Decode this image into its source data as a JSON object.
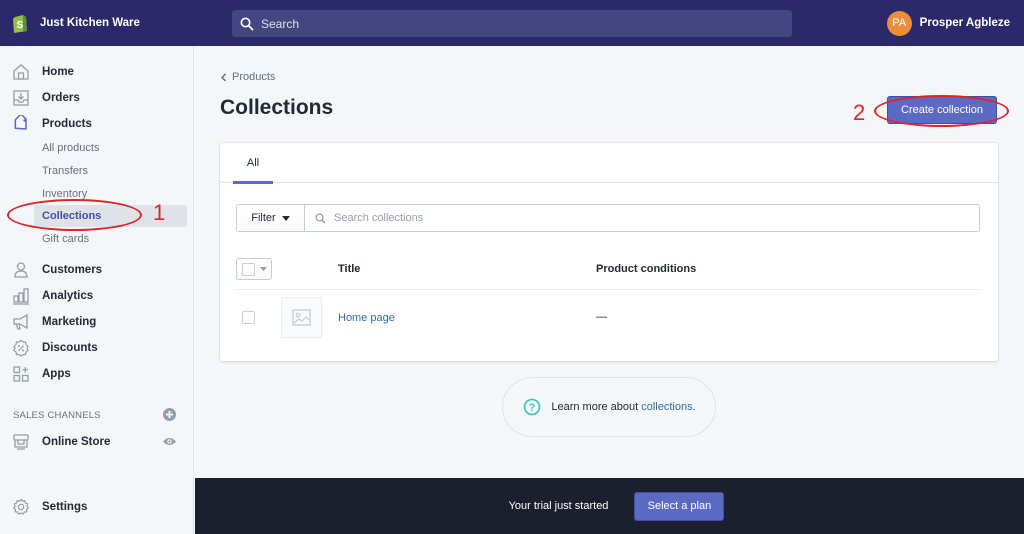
{
  "topbar": {
    "store_name": "Just Kitchen Ware",
    "search_placeholder": "Search",
    "user": {
      "initials": "PA",
      "name": "Prosper Agbleze",
      "avatar_color": "#ec8d3c"
    },
    "background_color": "#2b2969"
  },
  "sidebar": {
    "items": [
      {
        "label": "Home",
        "icon": "home-icon"
      },
      {
        "label": "Orders",
        "icon": "orders-icon"
      },
      {
        "label": "Products",
        "icon": "tag-icon"
      }
    ],
    "product_subitems": [
      {
        "label": "All products",
        "active": false
      },
      {
        "label": "Transfers",
        "active": false
      },
      {
        "label": "Inventory",
        "active": false
      },
      {
        "label": "Collections",
        "active": true
      },
      {
        "label": "Gift cards",
        "active": false
      }
    ],
    "items_after": [
      {
        "label": "Customers",
        "icon": "person-icon"
      },
      {
        "label": "Analytics",
        "icon": "bar-chart-icon"
      },
      {
        "label": "Marketing",
        "icon": "megaphone-icon"
      },
      {
        "label": "Discounts",
        "icon": "discount-badge-icon"
      },
      {
        "label": "Apps",
        "icon": "apps-icon"
      }
    ],
    "sales_channels_title": "SALES CHANNELS",
    "online_store": {
      "label": "Online Store",
      "icon": "store-icon"
    },
    "settings": {
      "label": "Settings",
      "icon": "gear-icon"
    }
  },
  "main": {
    "breadcrumb": "Products",
    "page_title": "Collections",
    "create_button": "Create collection",
    "tabs": [
      {
        "label": "All",
        "active": true
      }
    ],
    "filter_label": "Filter",
    "search_placeholder": "Search collections",
    "columns": [
      "Title",
      "Product conditions"
    ],
    "rows": [
      {
        "title": "Home page",
        "conditions": "—"
      }
    ],
    "learn_more": {
      "prefix": "Learn more about ",
      "link": "collections",
      "suffix": "."
    }
  },
  "trial_bar": {
    "text": "Your trial just started",
    "button": "Select a plan"
  },
  "annotations": [
    {
      "number": "1",
      "target": "Collections sidebar item"
    },
    {
      "number": "2",
      "target": "Create collection button"
    }
  ],
  "colors": {
    "accent": "#5c6ac4",
    "link": "#2e6da4",
    "annotation": "#d8262c",
    "trial_bar": "#1c1f2d"
  }
}
